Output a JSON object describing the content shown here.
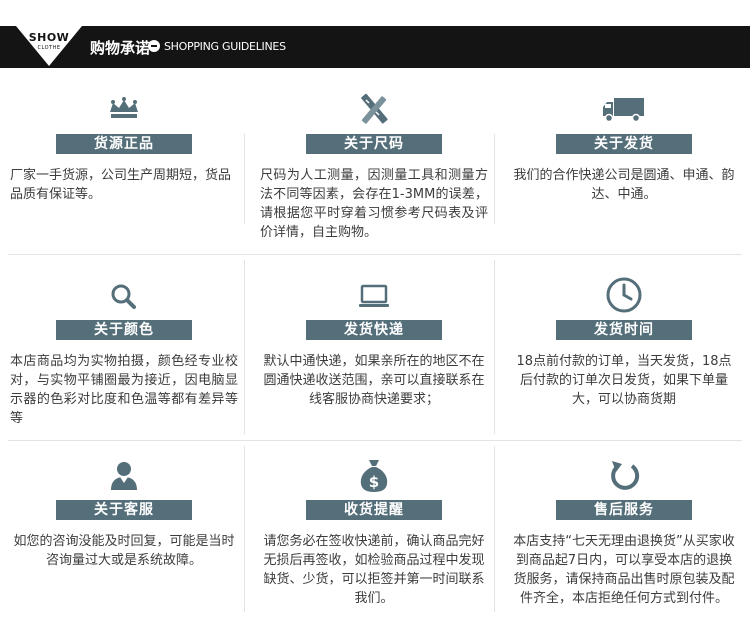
{
  "header": {
    "logo_top": "SHOW",
    "logo_bottom": "CLOTHE",
    "title": "购物承诺",
    "subtitle": "SHOPPING GUIDELINES"
  },
  "colors": {
    "header_bg": "#141414",
    "label_bg": "#546e7a",
    "icon": "#546e7a",
    "divider": "#e3e3e3"
  },
  "items": [
    {
      "icon": "crown-icon",
      "label": "货源正品",
      "text": "厂家一手货源，公司生产周期短，货品品质有保证等。"
    },
    {
      "icon": "ruler-pencil-icon",
      "label": "关于尺码",
      "text": "尺码为人工测量，因测量工具和测量方法不同等因素，会存在1-3MM的误差，请根据您平时穿着习惯参考尺码表及评价详情，自主购物。"
    },
    {
      "icon": "delivery-truck-icon",
      "label": "关于发货",
      "text": "我们的合作快递公司是圆通、申通、韵达、中通。"
    },
    {
      "icon": "magnifier-icon",
      "label": "关于颜色",
      "text": "本店商品均为实物拍摄，颜色经专业校对，与实物平铺圈最为接近，因电脑显示器的色彩对比度和色温等都有差异等等"
    },
    {
      "icon": "laptop-icon",
      "label": "发货快递",
      "text": "默认中通快递，如果亲所在的地区不在圆通快递收送范围，亲可以直接联系在线客服协商快递要求；"
    },
    {
      "icon": "clock-icon",
      "label": "发货时间",
      "text": "18点前付款的订单，当天发货，18点后付款的订单次日发货，如果下单量大，可以协商货期"
    },
    {
      "icon": "customer-service-icon",
      "label": "关于客服",
      "text": "如您的咨询没能及时回复，可能是当时咨询量过大或是系统故障。"
    },
    {
      "icon": "money-bag-icon",
      "label": "收货提醒",
      "text": "请您务必在签收快递前，确认商品完好无损后再签收，如检验商品过程中发现缺货、少货，可以拒签并第一时间联系我们。"
    },
    {
      "icon": "refresh-icon",
      "label": "售后服务",
      "text": "本店支持“七天无理由退换货”从买家收到商品起7日内，可以享受本店的退换货服务，请保持商品出售时原包装及配件齐全，本店拒绝任何方式到付件。"
    }
  ]
}
